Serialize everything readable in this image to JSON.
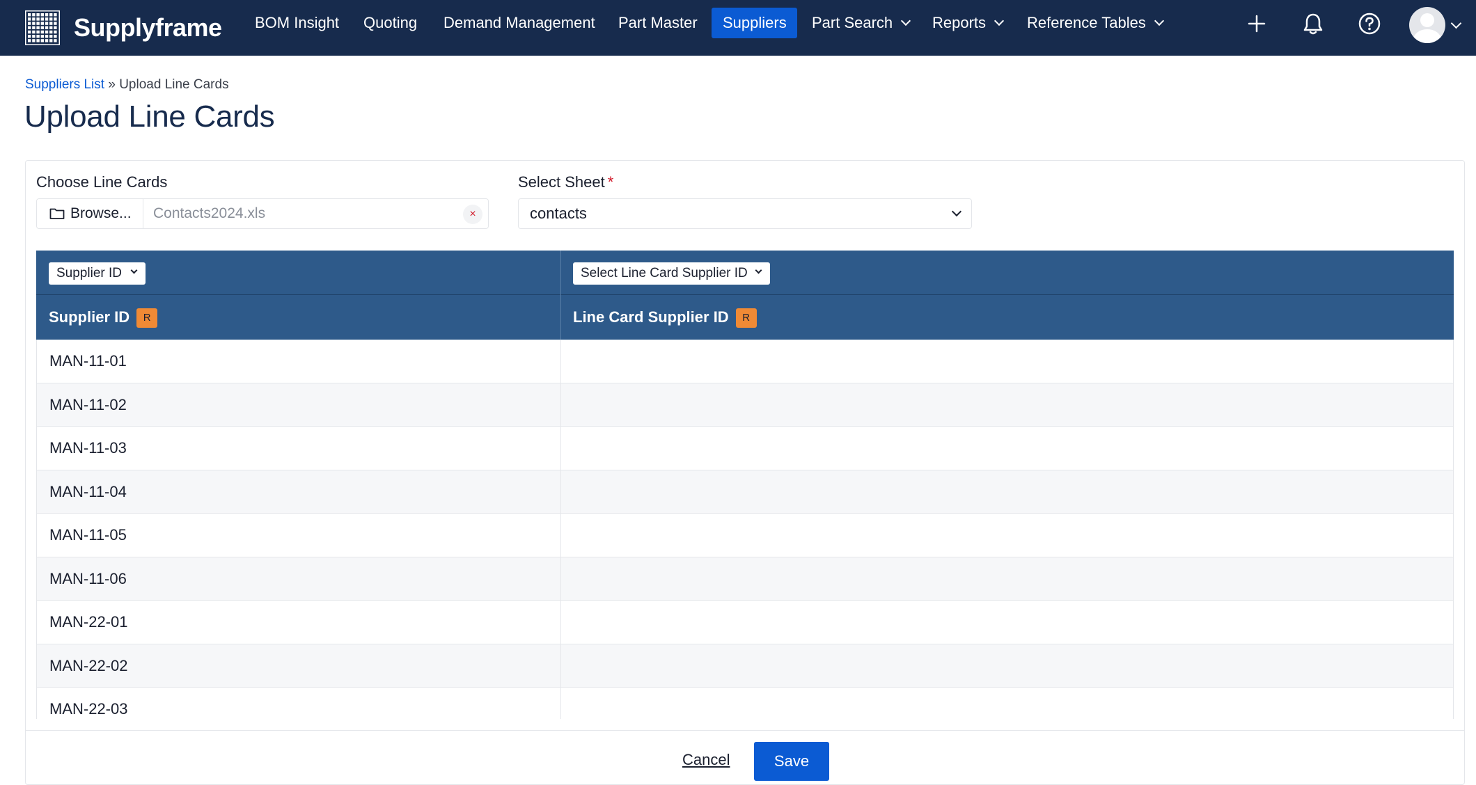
{
  "app": {
    "brand": "Supplyframe",
    "brand_icon": "grid-logo-icon"
  },
  "nav": {
    "items": [
      {
        "label": "BOM Insight"
      },
      {
        "label": "Quoting"
      },
      {
        "label": "Demand Management"
      },
      {
        "label": "Part Master"
      },
      {
        "label": "Suppliers",
        "active": true
      },
      {
        "label": "Part Search",
        "dropdown": true
      },
      {
        "label": "Reports",
        "dropdown": true
      },
      {
        "label": "Reference Tables",
        "dropdown": true
      }
    ],
    "icons": [
      "plus-icon",
      "bell-icon",
      "help-icon",
      "avatar"
    ]
  },
  "breadcrumb": {
    "parent": "Suppliers List",
    "separator": "»",
    "current": "Upload Line Cards"
  },
  "page": {
    "title": "Upload Line Cards"
  },
  "form": {
    "file": {
      "label": "Choose Line Cards",
      "browse_label": "Browse...",
      "file_name": "Contacts2024.xls",
      "clear_label": "×"
    },
    "sheet": {
      "label": "Select Sheet",
      "required_mark": "*",
      "value": "contacts"
    }
  },
  "table": {
    "columns": [
      {
        "mapping_select": "Supplier ID",
        "header": "Supplier ID",
        "badge": "R"
      },
      {
        "mapping_select": "Select Line Card Supplier ID",
        "header": "Line Card Supplier ID",
        "badge": "R"
      }
    ],
    "rows": [
      {
        "supplier_id": "MAN-11-01",
        "line_card_supplier_id": ""
      },
      {
        "supplier_id": "MAN-11-02",
        "line_card_supplier_id": ""
      },
      {
        "supplier_id": "MAN-11-03",
        "line_card_supplier_id": ""
      },
      {
        "supplier_id": "MAN-11-04",
        "line_card_supplier_id": ""
      },
      {
        "supplier_id": "MAN-11-05",
        "line_card_supplier_id": ""
      },
      {
        "supplier_id": "MAN-11-06",
        "line_card_supplier_id": ""
      },
      {
        "supplier_id": "MAN-22-01",
        "line_card_supplier_id": ""
      },
      {
        "supplier_id": "MAN-22-02",
        "line_card_supplier_id": ""
      },
      {
        "supplier_id": "MAN-22-03",
        "line_card_supplier_id": ""
      }
    ]
  },
  "footer": {
    "cancel_label": "Cancel",
    "save_label": "Save"
  },
  "colors": {
    "nav_bg": "#172b4d",
    "accent": "#0b5bd3",
    "table_header": "#2e5a8a",
    "badge": "#f08a35",
    "required": "#d11a2a"
  }
}
